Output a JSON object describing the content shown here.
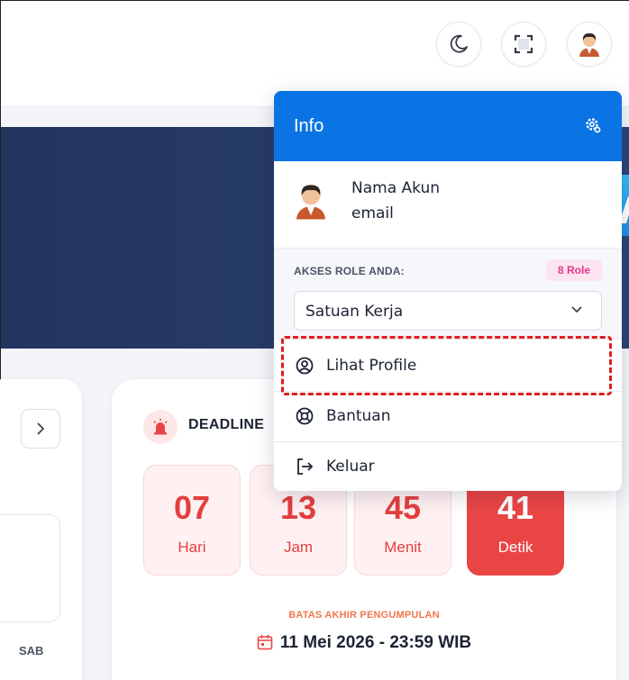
{
  "header": {
    "theme_toggle": "moon-icon",
    "fullscreen_toggle": "fullscreen-icon",
    "user_avatar": "avatar-icon"
  },
  "calendar": {
    "day_label": "SAB"
  },
  "deadline": {
    "title": "DEADLINE",
    "countdown": [
      {
        "value": "07",
        "unit": "Hari"
      },
      {
        "value": "13",
        "unit": "Jam"
      },
      {
        "value": "45",
        "unit": "Menit"
      },
      {
        "value": "41",
        "unit": "Detik"
      }
    ],
    "caption": "BATAS AKHIR PENGUMPULAN",
    "date": "11 Mei 2026 - 23:59 WIB"
  },
  "dropdown": {
    "title": "Info",
    "account": {
      "name": "Nama Akun",
      "email": "email"
    },
    "role": {
      "label": "AKSES ROLE ANDA:",
      "badge": "8 Role",
      "selected": "Satuan Kerja"
    },
    "items": [
      {
        "label": "Lihat Profile",
        "icon": "user-circle-icon"
      },
      {
        "label": "Bantuan",
        "icon": "lifebuoy-icon"
      },
      {
        "label": "Keluar",
        "icon": "logout-icon"
      }
    ]
  },
  "colors": {
    "primary": "#0b74e5",
    "danger": "#ea4545",
    "banner": "#23345f",
    "highlight": "#e11d22",
    "badge_text": "#e2378b"
  }
}
